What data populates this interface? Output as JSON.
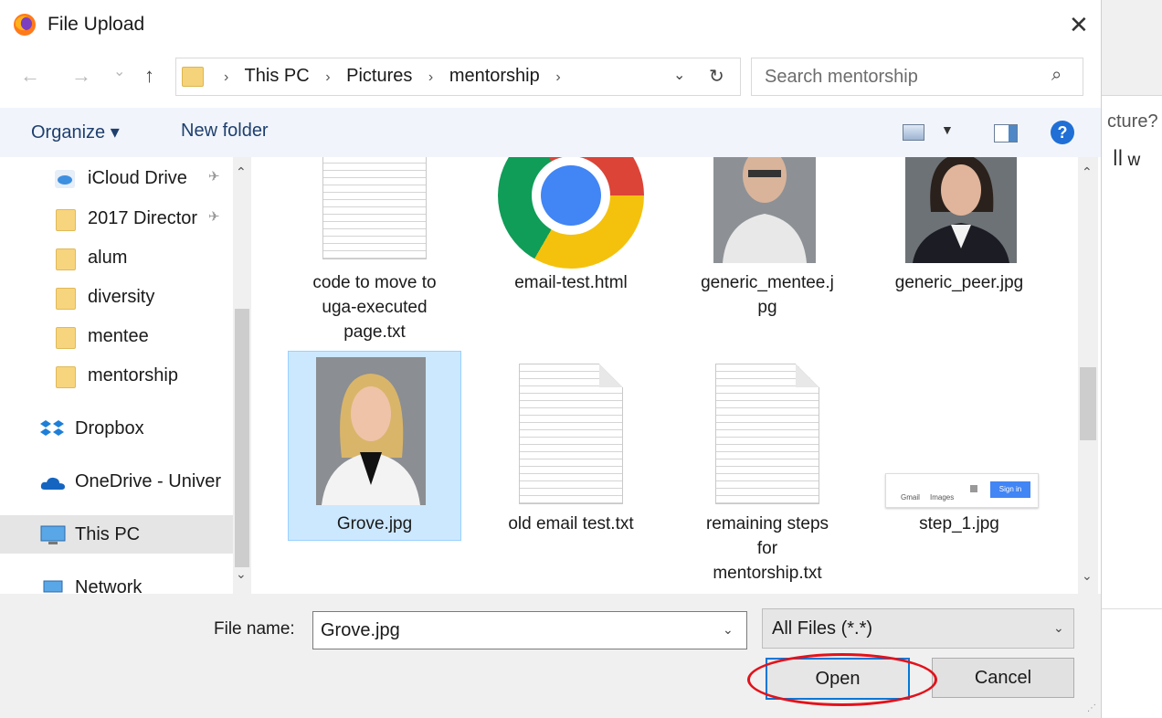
{
  "window": {
    "title": "File Upload",
    "close_glyph": "✕"
  },
  "nav": {
    "back": "←",
    "forward": "→",
    "recent": "⌄",
    "up": "↑"
  },
  "address": {
    "crumbs": [
      "This PC",
      "Pictures",
      "mentorship"
    ],
    "sep": "›",
    "dropdown": "⌄",
    "refresh": "↻"
  },
  "search": {
    "placeholder": "Search mentorship",
    "icon": "⌕"
  },
  "toolbar": {
    "organize": "Organize ▾",
    "new_folder": "New folder",
    "view_dropdown": "▼",
    "help": "?"
  },
  "sidebar": {
    "items": [
      {
        "label": "iCloud Drive",
        "icon": "cloud-icon",
        "pinned": true
      },
      {
        "label": "2017 Director",
        "icon": "folder-icon",
        "pinned": true
      },
      {
        "label": "alum",
        "icon": "folder-icon"
      },
      {
        "label": "diversity",
        "icon": "folder-icon"
      },
      {
        "label": "mentee",
        "icon": "folder-icon"
      },
      {
        "label": "mentorship",
        "icon": "folder-icon"
      },
      {
        "label": "Dropbox",
        "icon": "dropbox-icon"
      },
      {
        "label": "OneDrive - Univer",
        "icon": "onedrive-icon"
      },
      {
        "label": "This PC",
        "icon": "computer-icon",
        "selected": true
      },
      {
        "label": "Network",
        "icon": "network-icon"
      }
    ],
    "pin_glyph": "✈"
  },
  "files": [
    {
      "name": "code to move to uga-executed page.txt",
      "lines": [
        "code to move to",
        "uga-executed",
        "page.txt"
      ],
      "type": "text"
    },
    {
      "name": "email-test.html",
      "lines": [
        "email-test.html"
      ],
      "type": "chrome"
    },
    {
      "name": "generic_mentee.jpg",
      "lines": [
        "generic_mentee.j",
        "pg"
      ],
      "type": "photo"
    },
    {
      "name": "generic_peer.jpg",
      "lines": [
        "generic_peer.jpg"
      ],
      "type": "photo"
    },
    {
      "name": "Grove.jpg",
      "lines": [
        "Grove.jpg"
      ],
      "type": "photo",
      "selected": true
    },
    {
      "name": "old email test.txt",
      "lines": [
        "old email test.txt"
      ],
      "type": "text"
    },
    {
      "name": "remaining steps for mentorship.txt",
      "lines": [
        "remaining steps",
        "for",
        "mentorship.txt"
      ],
      "type": "text"
    },
    {
      "name": "step_1.jpg",
      "lines": [
        "step_1.jpg"
      ],
      "type": "screenshot",
      "thumb_text": [
        "Gmail",
        "Images",
        "Sign in"
      ]
    }
  ],
  "scroll": {
    "up": "⌃",
    "down": "⌄"
  },
  "bottom": {
    "file_name_label": "File name:",
    "file_name_value": "Grove.jpg",
    "filter_value": "All Files (*.*)",
    "dropdown": "⌄",
    "open": "Open",
    "cancel": "Cancel",
    "grip": "⋰"
  },
  "background": {
    "text1": "cture?",
    "text2": "ꟾꟾ w"
  },
  "colors": {
    "selection": "#cce8ff",
    "accent": "#0078d7",
    "highlight_ring": "#e3121b",
    "help": "#1f6fd6"
  }
}
